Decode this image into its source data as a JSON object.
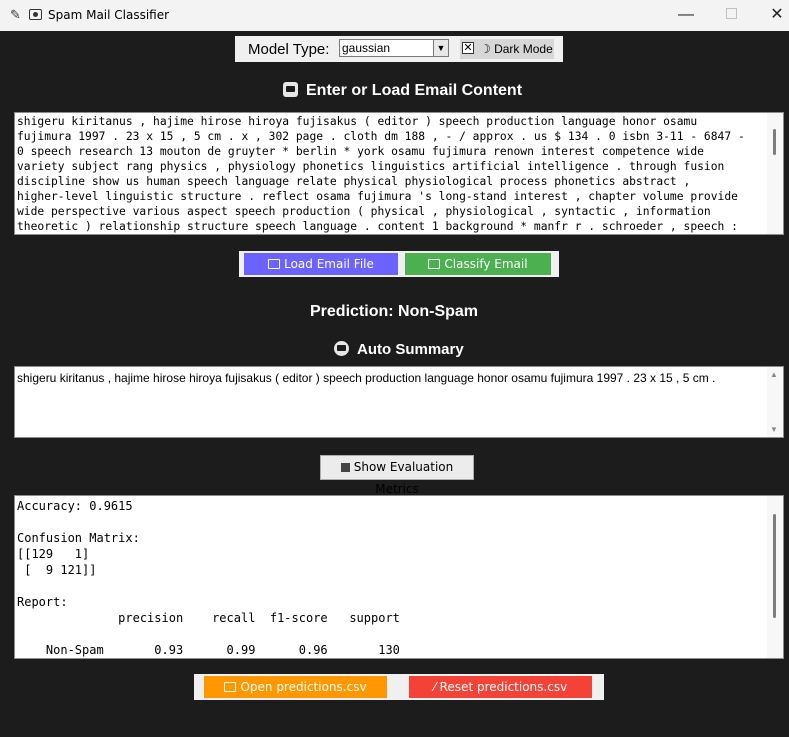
{
  "window": {
    "title": "Spam Mail Classifier",
    "minimize": "—",
    "close": "✕"
  },
  "model": {
    "label": "Model Type:",
    "selected": "gaussian",
    "dark_mode_label": "Dark Mode",
    "dark_mode_checked": true
  },
  "email": {
    "heading": "Enter or Load Email Content",
    "text": "shigeru kiritanus , hajime hirose hiroya fujisakus ( editor ) speech production language honor osamu\nfujimura 1997 . 23 x 15 , 5 cm . x , 302 page . cloth dm 188 , - / approx . us $ 134 . 0 isbn 3-11 - 6847 -\n0 speech research 13 mouton de gruyter * berlin * york osamu fujimura renown interest competence wide\nvariety subject rang physics , physiology phonetics linguistics artificial intelligence . through fusion\ndiscipline show us human speech language relate physical physiological process phonetics abstract ,\nhigher-level linguistic structure . reflect osama fujimura 's long-stand interest , chapter volume provide\nwide perspective various aspect speech production ( physical , physiological , syntactic , information\ntheoretic ) relationship structure speech language . content 1 background * manfr r . schroeder , speech :"
  },
  "buttons": {
    "load": "Load Email File",
    "classify": "Classify Email",
    "metrics": "Show Evaluation Metrics",
    "open_csv": "Open predictions.csv",
    "reset_csv": "Reset predictions.csv"
  },
  "prediction": {
    "text": "Prediction: Non-Spam"
  },
  "summary": {
    "heading": "Auto Summary",
    "text": "shigeru kiritanus , hajime hirose hiroya fujisakus ( editor ) speech production language honor osamu fujimura 1997 . 23 x 15 , 5 cm ."
  },
  "metrics": {
    "text": "Accuracy: 0.9615\n\nConfusion Matrix:\n[[129   1]\n [  9 121]]\n\nReport:\n              precision    recall  f1-score   support\n\n    Non-Spam       0.93      0.99      0.96       130"
  },
  "colors": {
    "background": "#1c1c1c",
    "load_button": "#6c63ff",
    "classify_button": "#4caf50",
    "open_button": "#ff9800",
    "reset_button": "#f44336"
  }
}
